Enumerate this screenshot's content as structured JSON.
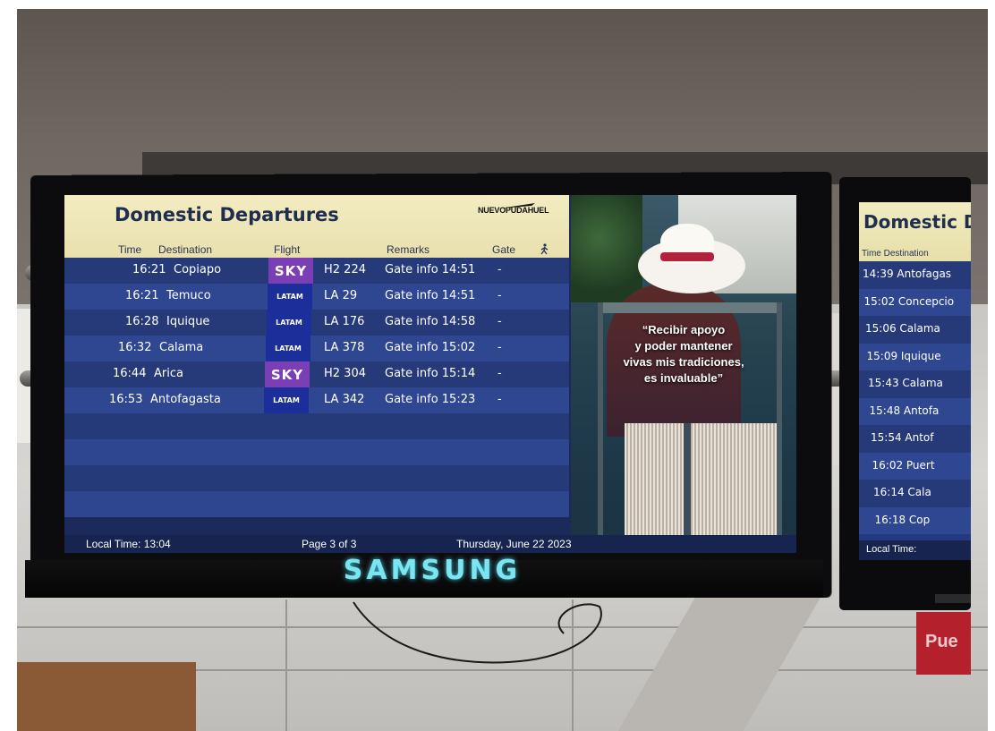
{
  "main_board": {
    "title": "Domestic Departures",
    "airport_logo": "NUEVOPUDAHUEL",
    "columns": {
      "time": "Time",
      "destination": "Destination",
      "flight": "Flight",
      "remarks": "Remarks",
      "gate": "Gate",
      "walk_icon": "walking-person-icon"
    },
    "rows": [
      {
        "time": "16:21",
        "destination": "Copiapo",
        "airline": "SKY",
        "flight": "H2 224",
        "remarks": "Gate info 14:51",
        "gate": "-"
      },
      {
        "time": "16:21",
        "destination": "Temuco",
        "airline": "LATAM",
        "flight": "LA 29",
        "remarks": "Gate info 14:51",
        "gate": "-"
      },
      {
        "time": "16:28",
        "destination": "Iquique",
        "airline": "LATAM",
        "flight": "LA 176",
        "remarks": "Gate info 14:58",
        "gate": "-"
      },
      {
        "time": "16:32",
        "destination": "Calama",
        "airline": "LATAM",
        "flight": "LA 378",
        "remarks": "Gate info 15:02",
        "gate": "-"
      },
      {
        "time": "16:44",
        "destination": "Arica",
        "airline": "SKY",
        "flight": "H2 304",
        "remarks": "Gate info 15:14",
        "gate": "-"
      },
      {
        "time": "16:53",
        "destination": "Antofagasta",
        "airline": "LATAM",
        "flight": "LA 342",
        "remarks": "Gate info 15:23",
        "gate": "-"
      }
    ],
    "footer": {
      "local_time": "Local Time:  13:04",
      "page": "Page 3 of 3",
      "date": "Thursday, June 22 2023"
    }
  },
  "ad": {
    "quote_lines": [
      "“Recibir apoyo",
      "y poder mantener",
      "vivas mis tradiciones,",
      "es invaluable”"
    ]
  },
  "tv_brand": "SAMSUNG",
  "secondary_board": {
    "title": "Domestic D",
    "columns": "Time  Destination",
    "rows": [
      "14:39  Antofagas",
      "15:02  Concepcio",
      "15:06  Calama",
      "15:09  Iquique",
      "15:43  Calama",
      "15:48  Antofa",
      "15:54  Antof",
      "16:02  Puert",
      "16:14  Cala",
      "16:18  Cop"
    ],
    "footer": "Local Time:"
  },
  "sign_text": "Pue",
  "colors": {
    "board_header": "#f3ecc1",
    "row_dark": "#263a7a",
    "row_light": "#2f4690",
    "sky": "#7b3fb5",
    "latam": "#1c2e9a",
    "brand_glow": "#7be5f2"
  }
}
